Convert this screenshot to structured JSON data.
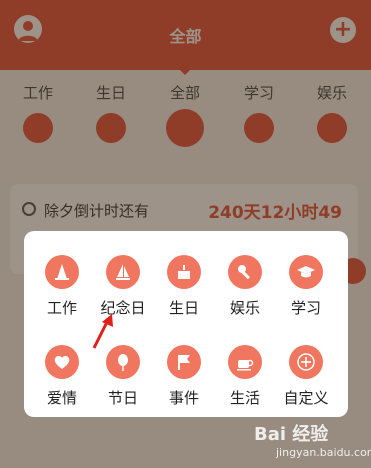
{
  "header": {
    "title": "全部"
  },
  "tabs": [
    {
      "label": "工作",
      "icon": "cone-icon"
    },
    {
      "label": "生日",
      "icon": "cake-icon"
    },
    {
      "label": "全部",
      "icon": "sail-icon"
    },
    {
      "label": "学习",
      "icon": "graduation-cap-icon"
    },
    {
      "label": "娱乐",
      "icon": "microphone-icon"
    }
  ],
  "countdown": {
    "label": "除夕倒计时还有",
    "value": "240天12小时49"
  },
  "popup": {
    "items": [
      {
        "label": "工作",
        "icon": "cone-icon"
      },
      {
        "label": "纪念日",
        "icon": "sail-icon"
      },
      {
        "label": "生日",
        "icon": "cake-icon"
      },
      {
        "label": "娱乐",
        "icon": "microphone-icon"
      },
      {
        "label": "学习",
        "icon": "graduation-cap-icon"
      },
      {
        "label": "爱情",
        "icon": "heart-icon"
      },
      {
        "label": "节日",
        "icon": "balloon-icon"
      },
      {
        "label": "事件",
        "icon": "flag-icon"
      },
      {
        "label": "生活",
        "icon": "coffee-cup-icon"
      },
      {
        "label": "自定义",
        "icon": "add-circle-icon"
      }
    ]
  },
  "watermark": {
    "brand": "Bai 经验",
    "url": "jingyan.baidu.com"
  },
  "colors": {
    "accent": "#e2523c",
    "icon_bg": "#f0765f",
    "countdown_value": "#e2523c"
  }
}
